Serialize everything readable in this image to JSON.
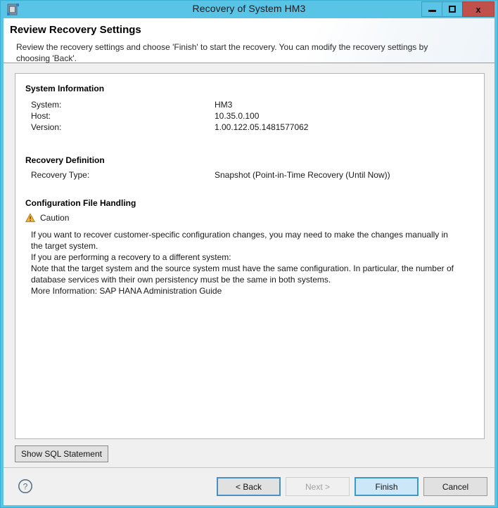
{
  "window": {
    "title": "Recovery of System HM3",
    "app_icon": "application-window-icon",
    "controls": {
      "minimize": "minimize-icon",
      "maximize": "maximize-icon",
      "close_label": "x"
    }
  },
  "wizard": {
    "title": "Review Recovery Settings",
    "description": "Review the recovery settings and choose 'Finish' to start the recovery. You can modify the recovery settings by choosing 'Back'."
  },
  "panel": {
    "system_information": {
      "heading": "System Information",
      "rows": [
        {
          "label": "System:",
          "value": "HM3"
        },
        {
          "label": "Host:",
          "value": "10.35.0.100"
        },
        {
          "label": "Version:",
          "value": "1.00.122.05.1481577062"
        }
      ]
    },
    "recovery_definition": {
      "heading": "Recovery Definition",
      "rows": [
        {
          "label": "Recovery Type:",
          "value": "Snapshot (Point-in-Time Recovery (Until Now))"
        }
      ]
    },
    "configuration_file_handling": {
      "heading": "Configuration File Handling",
      "caution_icon": "warning-triangle-icon",
      "caution_label": "Caution",
      "caution_color": "#e8a33d",
      "body_lines": [
        "If you want to recover customer-specific configuration changes, you may need to make the changes manually in",
        "the target system.",
        "If you are performing a recovery to a different system:",
        "Note that the target system and the source system must have the same configuration. In particular, the number of",
        "database services with their own persistency must be the same in both systems.",
        "More Information: SAP HANA Administration Guide"
      ]
    }
  },
  "actions": {
    "show_sql_label": "Show SQL Statement",
    "help_icon": "help-question-icon",
    "back_label": "< Back",
    "next_label": "Next >",
    "finish_label": "Finish",
    "cancel_label": "Cancel",
    "next_disabled": true,
    "finish_is_default": true
  },
  "colors": {
    "window_frame": "#5ac4e6",
    "close_button": "#c0504a",
    "primary_button": "#cce8f8",
    "primary_button_border": "#3c99c8",
    "panel_background": "#ffffff",
    "client_background": "#f0f0f0"
  }
}
